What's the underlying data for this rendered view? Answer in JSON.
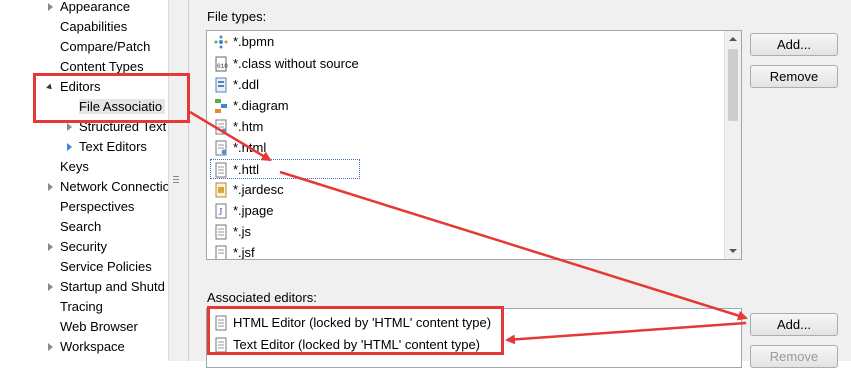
{
  "tree": {
    "items": [
      {
        "label": "Appearance",
        "indent": 1,
        "twisty": "closed"
      },
      {
        "label": "Capabilities",
        "indent": 1,
        "twisty": "none"
      },
      {
        "label": "Compare/Patch",
        "indent": 1,
        "twisty": "none"
      },
      {
        "label": "Content Types",
        "indent": 1,
        "twisty": "none"
      },
      {
        "label": "Editors",
        "indent": 1,
        "twisty": "open"
      },
      {
        "label": "File Associatio",
        "indent": 2,
        "twisty": "none",
        "selected": true
      },
      {
        "label": "Structured Text",
        "indent": 2,
        "twisty": "closed"
      },
      {
        "label": "Text Editors",
        "indent": 2,
        "twisty": "closed-blue"
      },
      {
        "label": "Keys",
        "indent": 1,
        "twisty": "none"
      },
      {
        "label": "Network Connectio",
        "indent": 1,
        "twisty": "closed"
      },
      {
        "label": "Perspectives",
        "indent": 1,
        "twisty": "none"
      },
      {
        "label": "Search",
        "indent": 1,
        "twisty": "none"
      },
      {
        "label": "Security",
        "indent": 1,
        "twisty": "closed"
      },
      {
        "label": "Service Policies",
        "indent": 1,
        "twisty": "none"
      },
      {
        "label": "Startup and Shutd",
        "indent": 1,
        "twisty": "closed"
      },
      {
        "label": "Tracing",
        "indent": 1,
        "twisty": "none"
      },
      {
        "label": "Web Browser",
        "indent": 1,
        "twisty": "none"
      },
      {
        "label": "Workspace",
        "indent": 1,
        "twisty": "closed"
      }
    ]
  },
  "file_types": {
    "label": "File types:",
    "items": [
      {
        "text": "*.bpmn",
        "icon": "bpmn-icon"
      },
      {
        "text": "*.class without source",
        "icon": "class-file-icon"
      },
      {
        "text": "*.ddl",
        "icon": "ddl-icon"
      },
      {
        "text": "*.diagram",
        "icon": "diagram-icon"
      },
      {
        "text": "*.htm",
        "icon": "html-file-icon"
      },
      {
        "text": "*.html",
        "icon": "html-file-icon"
      },
      {
        "text": "*.httl",
        "icon": "text-file-icon",
        "selected": true
      },
      {
        "text": "*.jardesc",
        "icon": "jardesc-icon"
      },
      {
        "text": "*.jpage",
        "icon": "jpage-icon"
      },
      {
        "text": "*.js",
        "icon": "js-file-icon"
      },
      {
        "text": "*.jsf",
        "icon": "jsf-file-icon"
      }
    ],
    "add_label": "Add...",
    "remove_label": "Remove"
  },
  "associated_editors": {
    "label": "Associated editors:",
    "items": [
      {
        "text": "HTML Editor (locked by 'HTML' content type)",
        "icon": "html-editor-icon"
      },
      {
        "text": "Text Editor (locked by 'HTML' content type)",
        "icon": "text-editor-icon"
      }
    ],
    "add_label": "Add...",
    "remove_label": "Remove"
  },
  "colors": {
    "annotation": "#e53935",
    "selection_border": "#3a6fc4",
    "panel_bg": "#f0f0f0"
  }
}
